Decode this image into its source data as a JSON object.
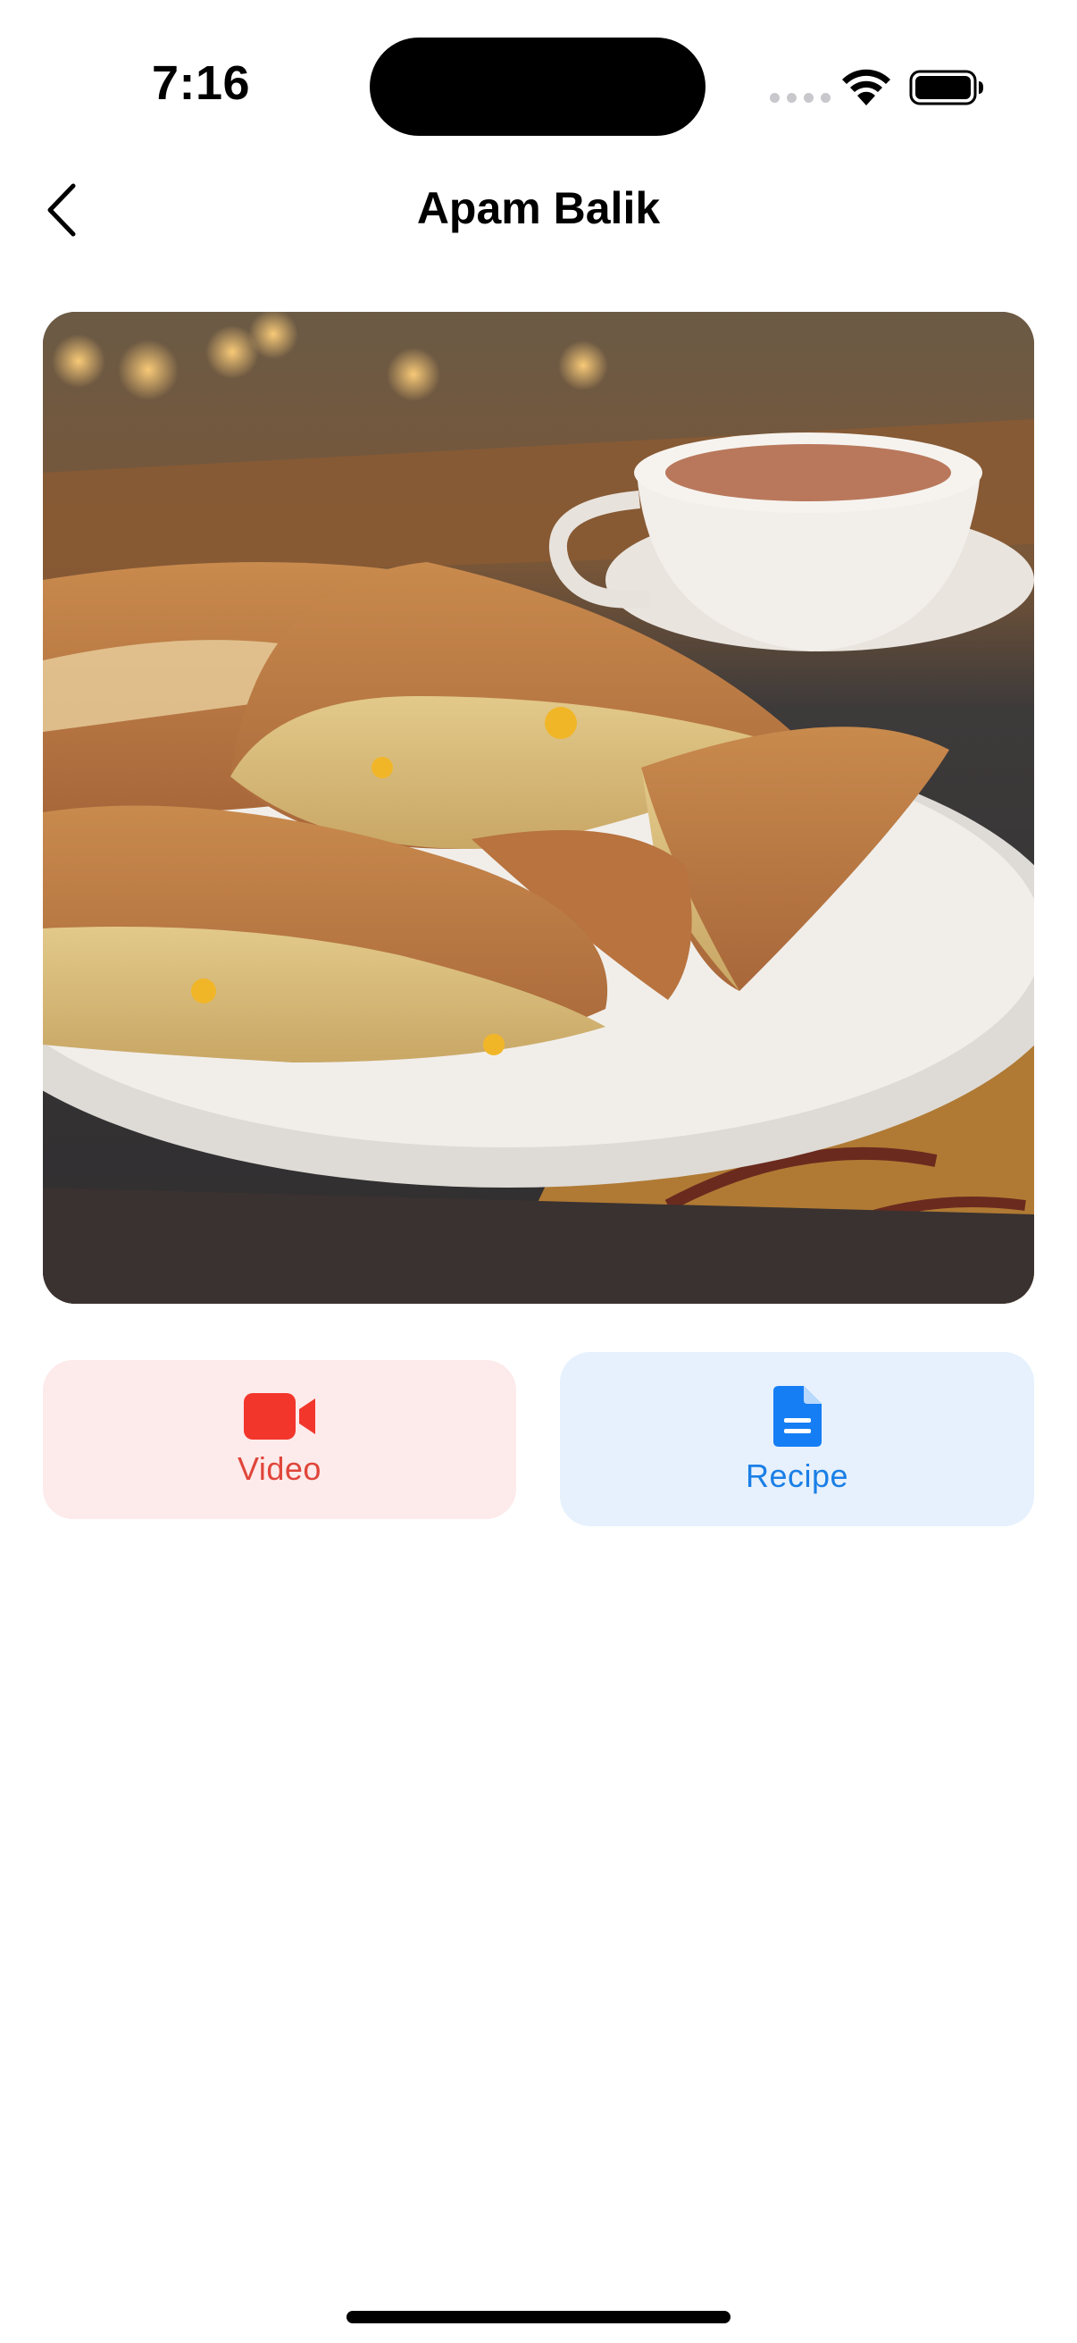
{
  "status_bar": {
    "time": "7:16"
  },
  "nav": {
    "title": "Apam Balik",
    "back_icon": "chevron-left-icon"
  },
  "hero": {
    "alt": "Apam Balik"
  },
  "actions": {
    "video": {
      "label": "Video",
      "icon": "video-camera-icon",
      "color": "#e0453a",
      "background": "#fdeaea"
    },
    "recipe": {
      "label": "Recipe",
      "icon": "document-icon",
      "color": "#1a7fe6",
      "background": "#e6f1fd"
    }
  }
}
